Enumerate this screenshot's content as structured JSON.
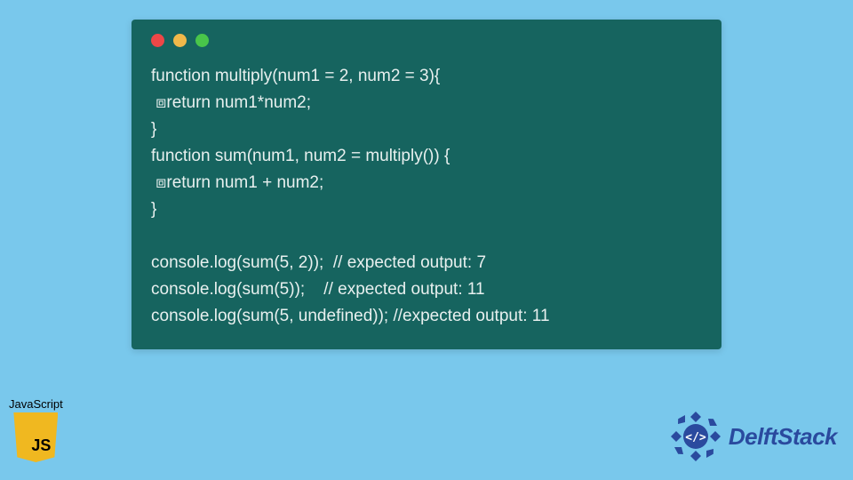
{
  "code": {
    "lines": "function multiply(num1 = 2, num2 = 3){\n ⧈return num1*num2;\n}\nfunction sum(num1, num2 = multiply()) {\n ⧈return num1 + num2;\n}\n\nconsole.log(sum(5, 2));  // expected output: 7\nconsole.log(sum(5));    // expected output: 11\nconsole.log(sum(5, undefined)); //expected output: 11"
  },
  "badges": {
    "js_label": "JavaScript",
    "brand": "DelftStack"
  },
  "colors": {
    "bg": "#79c8ec",
    "panel": "#16645f",
    "js": "#f0b820",
    "brand": "#2a4a9e"
  }
}
